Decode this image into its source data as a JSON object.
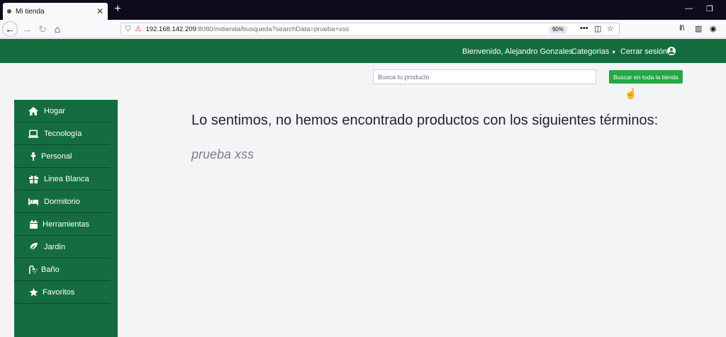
{
  "browser": {
    "tab_title": "Mi tienda",
    "new_tab": "+",
    "url_host": "192.168.142.209",
    "url_path": ":8080/mitienda/busqueda?searchData=prueba+xss",
    "zoom": "90%"
  },
  "header": {
    "welcome": "Bienvenido, Alejandro Gonzales",
    "categories": "Categorias",
    "logout": "Cerrar sesión"
  },
  "search": {
    "placeholder": "Busca tu producto",
    "button": "Buscar en toda la tienda"
  },
  "sidebar": {
    "items": [
      {
        "label": "Hogar",
        "icon": "home-icon"
      },
      {
        "label": "Tecnología",
        "icon": "laptop-icon"
      },
      {
        "label": "Personal",
        "icon": "person-icon"
      },
      {
        "label": "Linea Blanca",
        "icon": "gift-icon"
      },
      {
        "label": "Dormitorio",
        "icon": "bed-icon"
      },
      {
        "label": "Herramientas",
        "icon": "calendar-icon"
      },
      {
        "label": "Jardin",
        "icon": "leaf-icon"
      },
      {
        "label": "Baño",
        "icon": "shower-icon"
      },
      {
        "label": "Favoritos",
        "icon": "star-icon"
      }
    ]
  },
  "main": {
    "message": "Lo sentimos, no hemos encontrado productos con los siguientes términos:",
    "search_term": "prueba xss"
  },
  "colors": {
    "brand_green": "#156d3f",
    "button_green": "#28a745"
  }
}
